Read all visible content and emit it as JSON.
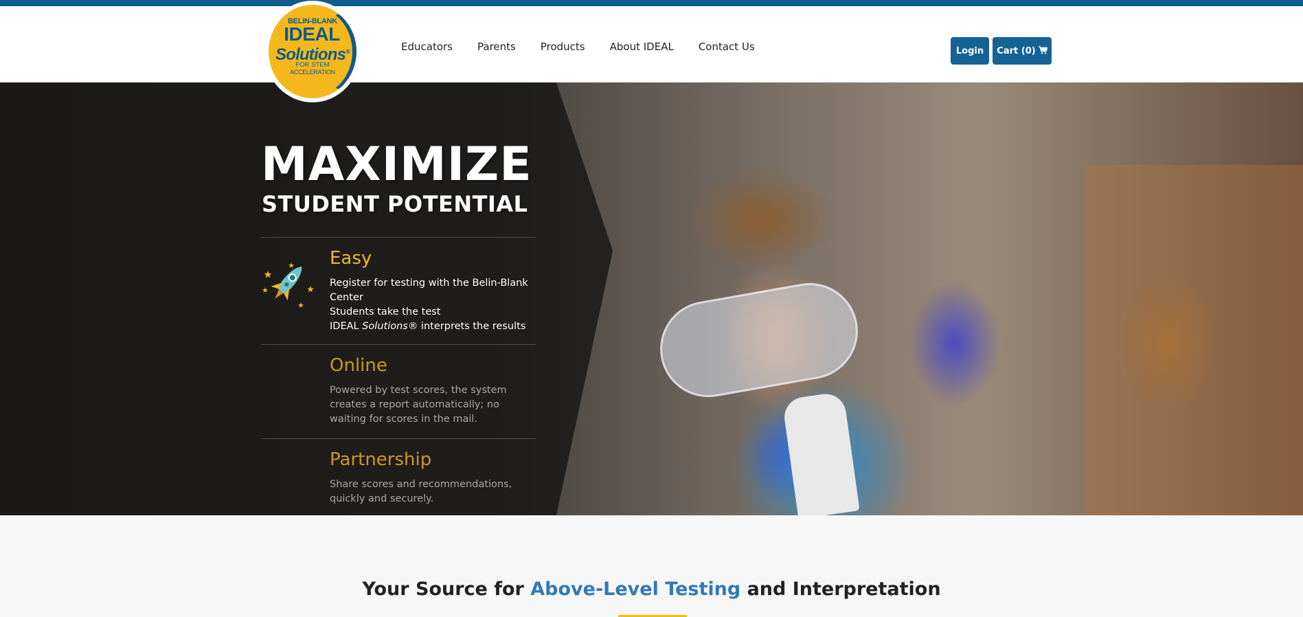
{
  "logo": {
    "line1": "BELIN-BLANK",
    "line2": "IDEAL",
    "line3": "Solutions",
    "reg": "®",
    "line4": "FOR STEM",
    "line5": "ACCELERATION"
  },
  "nav": {
    "items": [
      {
        "label": "Educators"
      },
      {
        "label": "Parents"
      },
      {
        "label": "Products"
      },
      {
        "label": "About IDEAL"
      },
      {
        "label": "Contact Us"
      }
    ]
  },
  "header_buttons": {
    "login": "Login",
    "cart": "Cart (0)",
    "cart_icon": "shopping-cart-icon"
  },
  "hero": {
    "title_main": "MAXIMIZE",
    "title_sub": "STUDENT POTENTIAL",
    "features": [
      {
        "title": "Easy",
        "icon": "rocket-icon",
        "lines": [
          "Register for testing with the Belin-Blank Center",
          "Students take the test"
        ],
        "line3_prefix": "IDEAL ",
        "line3_italic": "Solutions",
        "line3_suffix": "® interprets the results"
      },
      {
        "title": "Online",
        "body": "Powered by test scores, the system creates a report automatically; no waiting for scores in the mail."
      },
      {
        "title": "Partnership",
        "body": "Share scores and recommendations, quickly and securely."
      }
    ]
  },
  "section": {
    "prefix": "Your Source for ",
    "accent": "Above-Level Testing",
    "suffix": " and Interpretation"
  },
  "colors": {
    "brand_blue": "#0f5a8a",
    "button_blue": "#156394",
    "accent_gold": "#f5b81c",
    "link_blue": "#2f7ab8"
  }
}
